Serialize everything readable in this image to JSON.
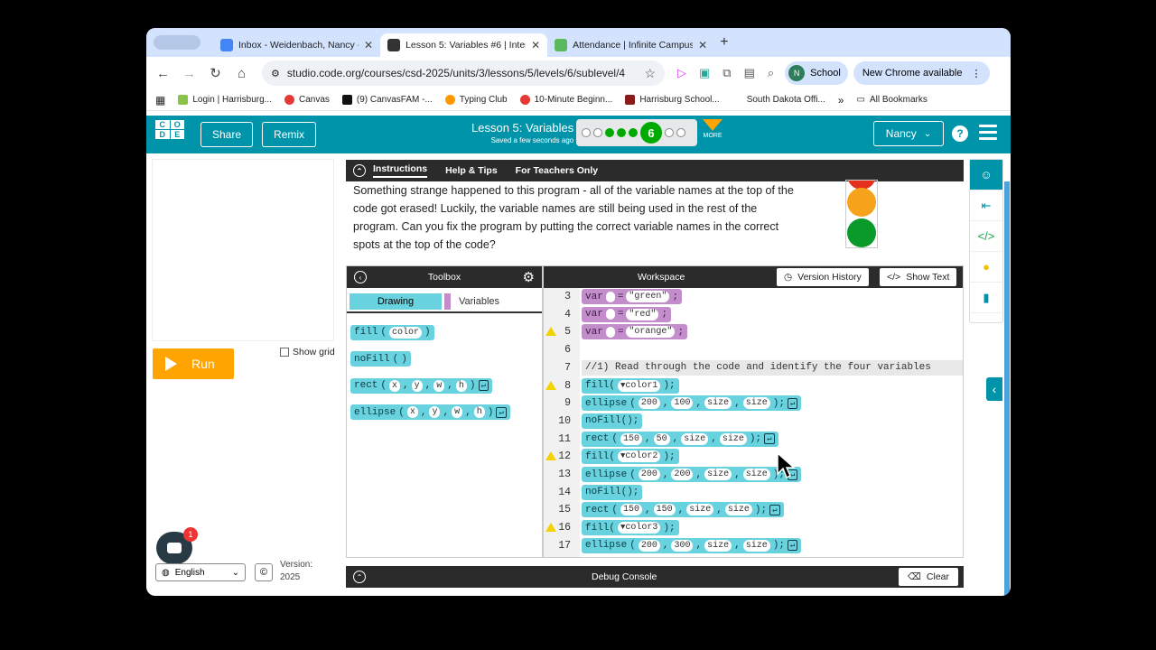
{
  "browser": {
    "tabs": [
      {
        "title": "Inbox - Weidenbach, Nancy -",
        "color": "#4285f4"
      },
      {
        "title": "Lesson 5: Variables #6 | Intera",
        "color": "#333333"
      },
      {
        "title": "Attendance | Infinite Campus",
        "color": "#5cb85c"
      }
    ],
    "url": "studio.code.org/courses/csd-2025/units/3/lessons/5/levels/6/sublevel/4",
    "profile_initial": "N",
    "profile_label": "School",
    "update_label": "New Chrome available",
    "bookmarks": [
      {
        "label": "Login | Harrisburg...",
        "color": "#8bc34a"
      },
      {
        "label": "Canvas",
        "color": "#e53935"
      },
      {
        "label": "(9) CanvasFAM -...",
        "color": "#111111"
      },
      {
        "label": "Typing Club",
        "color": "#ff9800"
      },
      {
        "label": "10-Minute Beginn...",
        "color": "#e53935"
      },
      {
        "label": "Harrisburg School...",
        "color": "#8b1a1a"
      },
      {
        "label": "South Dakota Offi...",
        "color": "#ffffff"
      }
    ],
    "bookmarks_more": "»",
    "all_bookmarks": "All Bookmarks"
  },
  "header": {
    "logo": [
      "C",
      "O",
      "D",
      "E"
    ],
    "share": "Share",
    "remix": "Remix",
    "lesson_title": "Lesson 5: Variables",
    "saved": "Saved a few seconds ago",
    "current_level": "6",
    "more": "MORE",
    "user": "Nancy"
  },
  "left": {
    "run": "Run",
    "show_grid": "Show grid",
    "badge": "1",
    "language": "English",
    "version_label": "Version:",
    "version_value": "2025"
  },
  "instructions": {
    "tabs": [
      "Instructions",
      "Help & Tips",
      "For Teachers Only"
    ],
    "text": "Something strange happened to this program - all of the variable names at the top of the code got erased! Luckily, the variable names are still being used in the rest of the program. Can you fix the program by putting the correct variable names in the correct spots at the top of the code?"
  },
  "toolbox": {
    "title": "Toolbox",
    "categories": [
      "Drawing",
      "Variables"
    ],
    "blocks": [
      {
        "fn": "fill",
        "args": [
          "color"
        ],
        "ret": false
      },
      {
        "fn": "noFill",
        "args": [],
        "ret": false
      },
      {
        "fn": "rect",
        "args": [
          "x",
          "y",
          "w",
          "h"
        ],
        "ret": true
      },
      {
        "fn": "ellipse",
        "args": [
          "x",
          "y",
          "w",
          "h"
        ],
        "ret": true
      }
    ]
  },
  "workspace": {
    "title": "Workspace",
    "version_history": "Version History",
    "show_text": "Show Text",
    "lines": [
      {
        "n": "3",
        "kind": "var",
        "value": "\"green\""
      },
      {
        "n": "4",
        "kind": "var",
        "value": "\"red\""
      },
      {
        "n": "5",
        "kind": "var",
        "value": "\"orange\"",
        "warn": true
      },
      {
        "n": "6",
        "kind": "blank"
      },
      {
        "n": "7",
        "kind": "comment",
        "text": "//1) Read through the code and identify the four variables"
      },
      {
        "n": "8",
        "kind": "fill",
        "arg": "color1",
        "warn": true
      },
      {
        "n": "9",
        "kind": "call",
        "fn": "ellipse",
        "args": [
          "200",
          "100",
          "size",
          "size"
        ]
      },
      {
        "n": "10",
        "kind": "nofill"
      },
      {
        "n": "11",
        "kind": "call",
        "fn": "rect",
        "args": [
          "150",
          "50",
          "size",
          "size"
        ]
      },
      {
        "n": "12",
        "kind": "fill",
        "arg": "color2",
        "warn": true
      },
      {
        "n": "13",
        "kind": "call",
        "fn": "ellipse",
        "args": [
          "200",
          "200",
          "size",
          "size"
        ]
      },
      {
        "n": "14",
        "kind": "nofill"
      },
      {
        "n": "15",
        "kind": "call",
        "fn": "rect",
        "args": [
          "150",
          "150",
          "size",
          "size"
        ]
      },
      {
        "n": "16",
        "kind": "fill",
        "arg": "color3",
        "warn": true
      },
      {
        "n": "17",
        "kind": "call",
        "fn": "ellipse",
        "args": [
          "200",
          "300",
          "size",
          "size"
        ]
      }
    ]
  },
  "debug": {
    "title": "Debug Console",
    "clear": "Clear"
  },
  "colors": {
    "teal": "#0094ab",
    "block": "#68d2df",
    "var_block": "#c38dcc",
    "run": "#ffa400"
  }
}
